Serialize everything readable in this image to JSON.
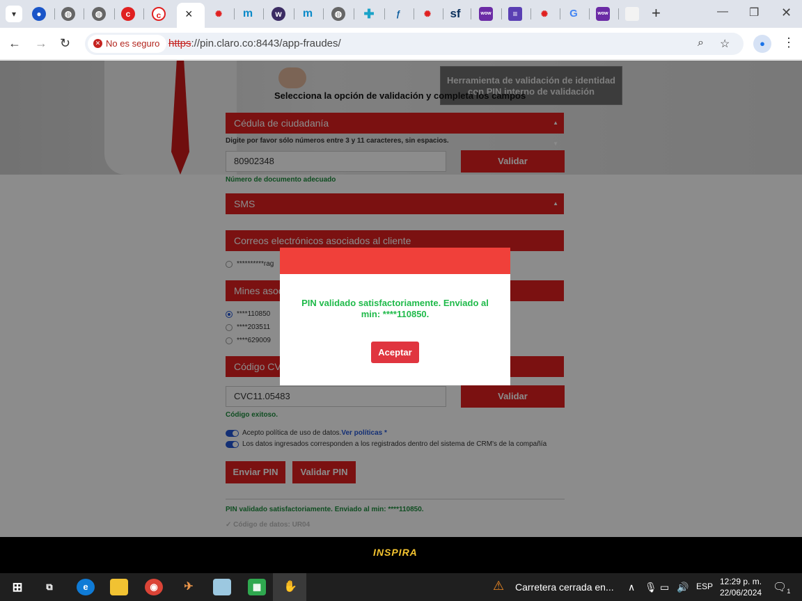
{
  "browser": {
    "active_tab_close": "×",
    "new_tab": "+",
    "security_label": "No es seguro",
    "url_protocol": "https",
    "url_rest": "://pin.claro.co:8443/app-fraudes/",
    "tab_icons": [
      "globe",
      "globe",
      "logo-b",
      "logo-c",
      "logo-d",
      "logo-m",
      "logo-w",
      "logo-m",
      "globe",
      "plus",
      "logo-f",
      "logo-d",
      "sf",
      "wow",
      "notes",
      "logo-d",
      "google",
      "wow",
      "blank"
    ]
  },
  "hero": {
    "box_text": "Herramienta de validación de identidad con PIN interno de validación",
    "heading": "Selecciona la opción de validación y completa los campos"
  },
  "form": {
    "doc_type": "Cédula de ciudadanía",
    "doc_hint": "Digite por favor sólo números entre 3 y 11 caracteres, sin espacios.",
    "doc_value": "80902348",
    "validate_label": "Validar",
    "doc_ok": "Número de documento adecuado",
    "channel": "SMS",
    "emails_header": "Correos electrónicos asociados al cliente",
    "email_option": "**********rag",
    "mines_header": "Mines asociados",
    "mines": [
      "****110850",
      "****203511",
      "****629009"
    ],
    "cvc_header": "Código CVC",
    "cvc_value": "CVC11.05483",
    "cvc_ok": "Código exitoso.",
    "policy_text": "Acepto política de uso de datos.",
    "policy_link": "Ver políticas *",
    "crm_text": "Los datos ingresados corresponden a los registrados dentro del sistema de CRM's de la compañía",
    "send_pin": "Enviar PIN",
    "validate_pin": "Validar PIN",
    "result": "PIN validado satisfactoriamente. Enviado al min: ****110850.",
    "data_code": "✓ Código de datos: UR04"
  },
  "modal": {
    "message": "PIN validado satisfactoriamente. Enviado al min: ****110850.",
    "accept": "Aceptar"
  },
  "footer": {
    "logo_text": "INSPIRA"
  },
  "taskbar": {
    "news": "Carretera cerrada en...",
    "lang": "ESP",
    "time": "12:29 p. m.",
    "date": "22/06/2024",
    "notif_count": "1"
  }
}
